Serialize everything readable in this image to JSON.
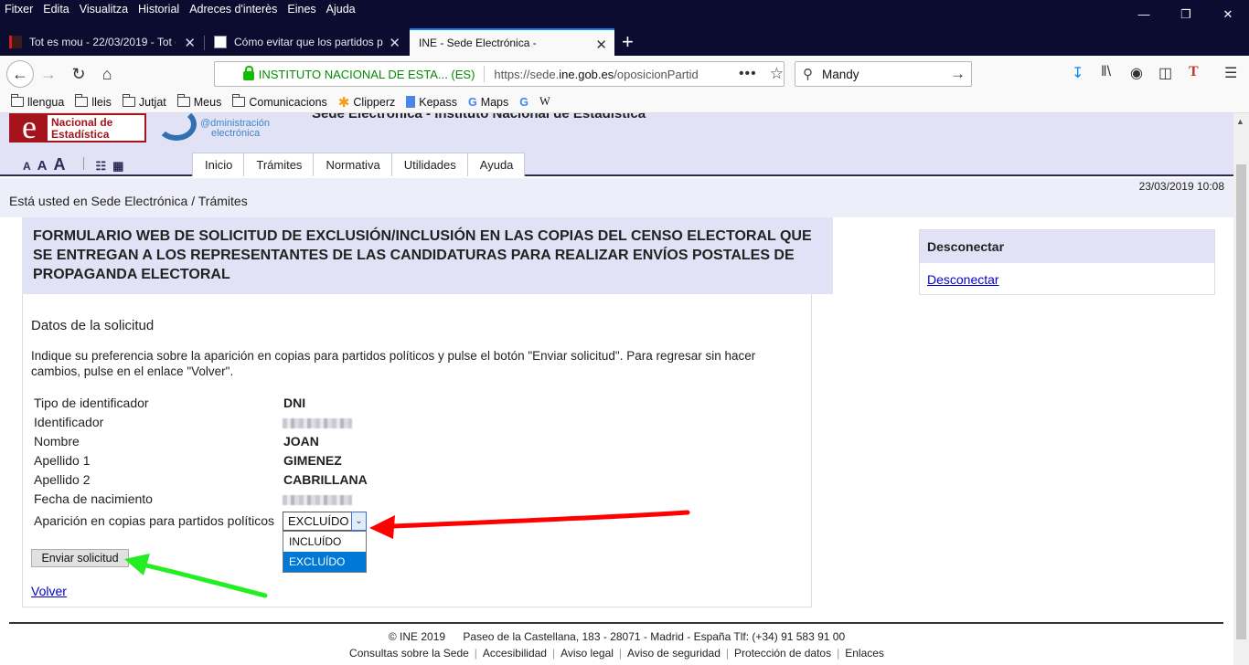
{
  "browser": {
    "menu": [
      "Fitxer",
      "Edita",
      "Visualitza",
      "Historial",
      "Adreces d'interès",
      "Eines",
      "Ajuda"
    ],
    "tabs": [
      {
        "label": "Tot es mou - 22/03/2019 - Tot e"
      },
      {
        "label": "Cómo evitar que los partidos p"
      },
      {
        "label": "INE - Sede Electrónica -"
      }
    ],
    "url_identity": "INSTITUTO NACIONAL DE ESTA... (ES)",
    "url_prefix": "https://sede.",
    "url_host": "ine.gob.es",
    "url_path": "/oposicionPartid",
    "search_value": "Mandy",
    "bookmarks": [
      "llengua",
      "lleis",
      "Jutjat",
      "Meus",
      "Comunicacions",
      "Clipperz",
      "Kepass",
      "Maps",
      "W"
    ],
    "accent_color": "#0a84ff"
  },
  "header": {
    "ine_logo_line1": "Nacional de",
    "ine_logo_line2": "Estadística",
    "adm_logo_line1": "@dministración",
    "adm_logo_line2": "electrónica",
    "site_title": "Sede Electrónica - Instituto Nacional de Estadística",
    "font_a": "A",
    "nav": [
      "Inicio",
      "Trámites",
      "Normativa",
      "Utilidades",
      "Ayuda"
    ]
  },
  "breadcrumb": {
    "text": "Está usted en Sede Electrónica",
    "separator": "/",
    "current": "Trámites",
    "datetime": "23/03/2019 10:08"
  },
  "form": {
    "title": "FORMULARIO WEB DE SOLICITUD DE EXCLUSIÓN/INCLUSIÓN EN LAS COPIAS DEL CENSO ELECTORAL QUE SE ENTREGAN A LOS REPRESENTANTES DE LAS CANDIDATURAS PARA REALIZAR ENVÍOS POSTALES DE PROPAGANDA ELECTORAL",
    "section_title": "Datos de la solicitud",
    "instructions": "Indique su preferencia sobre la aparición en copias para partidos políticos y pulse el botón \"Enviar solicitud\". Para regresar sin hacer cambios, pulse en el enlace \"Volver\".",
    "fields": [
      {
        "label": "Tipo de identificador",
        "value": "DNI"
      },
      {
        "label": "Identificador",
        "value": ""
      },
      {
        "label": "Nombre",
        "value": "JOAN"
      },
      {
        "label": "Apellido 1",
        "value": "GIMENEZ"
      },
      {
        "label": "Apellido 2",
        "value": "CABRILLANA"
      },
      {
        "label": "Fecha de nacimiento",
        "value": ""
      }
    ],
    "select_label": "Aparición en copias para partidos políticos",
    "select_value": "EXCLUÍDO",
    "select_options": [
      "INCLUÍDO",
      "EXCLUÍDO"
    ],
    "submit_label": "Enviar solicitud",
    "back_link": "Volver"
  },
  "sidebar": {
    "heading": "Desconectar",
    "link": "Desconectar"
  },
  "footer": {
    "copyright": "©  INE 2019",
    "address": "Paseo de la Castellana, 183 - 28071 - Madrid - España Tlf: (+34) 91 583 91 00",
    "links": [
      "Consultas sobre la Sede",
      "Accesibilidad",
      "Aviso legal",
      "Aviso de seguridad",
      "Protección de datos",
      "Enlaces"
    ]
  },
  "annotations": {
    "red_arrow_color": "#ff0000",
    "green_arrow_color": "#22ee22"
  }
}
